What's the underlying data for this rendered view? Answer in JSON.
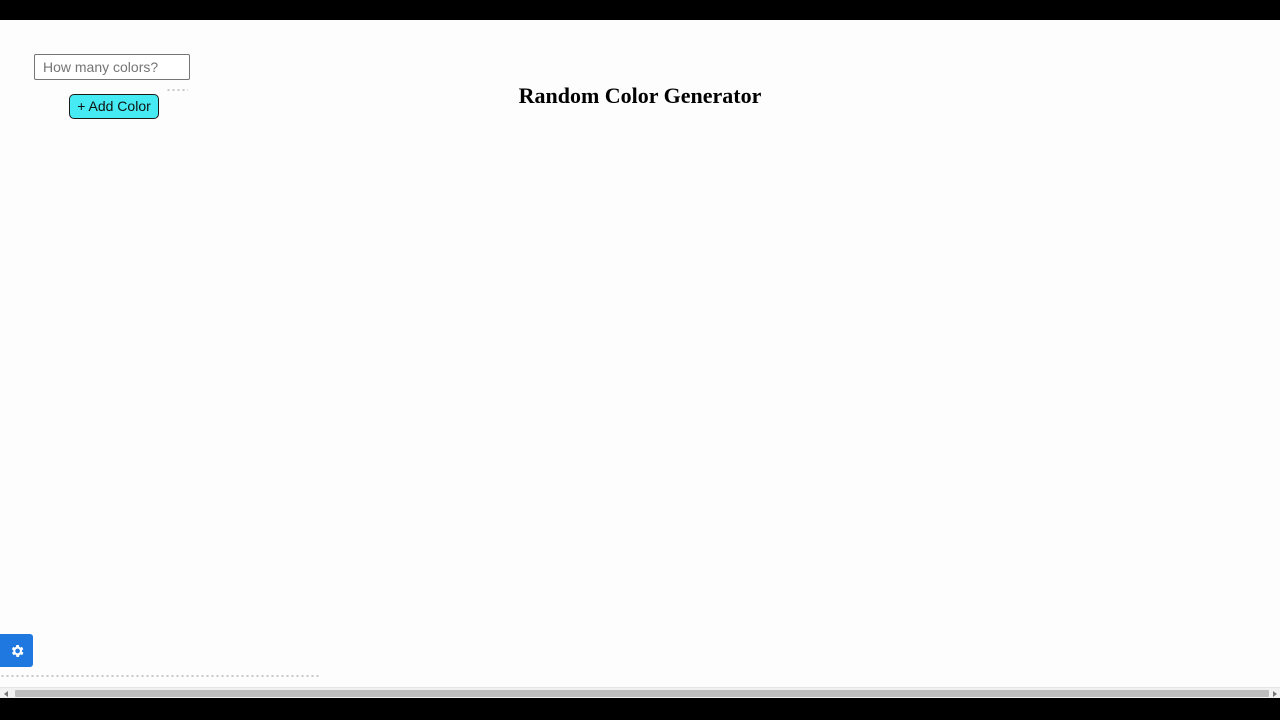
{
  "controls": {
    "count_placeholder": "How many colors?",
    "count_value": "",
    "add_button_label": "+ Add Color"
  },
  "header": {
    "title": "Random Color Generator"
  },
  "icons": {
    "settings": "gear-icon",
    "scroll_left": "chevron-left-icon",
    "scroll_right": "chevron-right-icon"
  },
  "colors": {
    "add_button_bg": "#45eaf2",
    "settings_button_bg": "#1e78e0",
    "page_bg": "#fdfdfd"
  },
  "generated_colors": []
}
